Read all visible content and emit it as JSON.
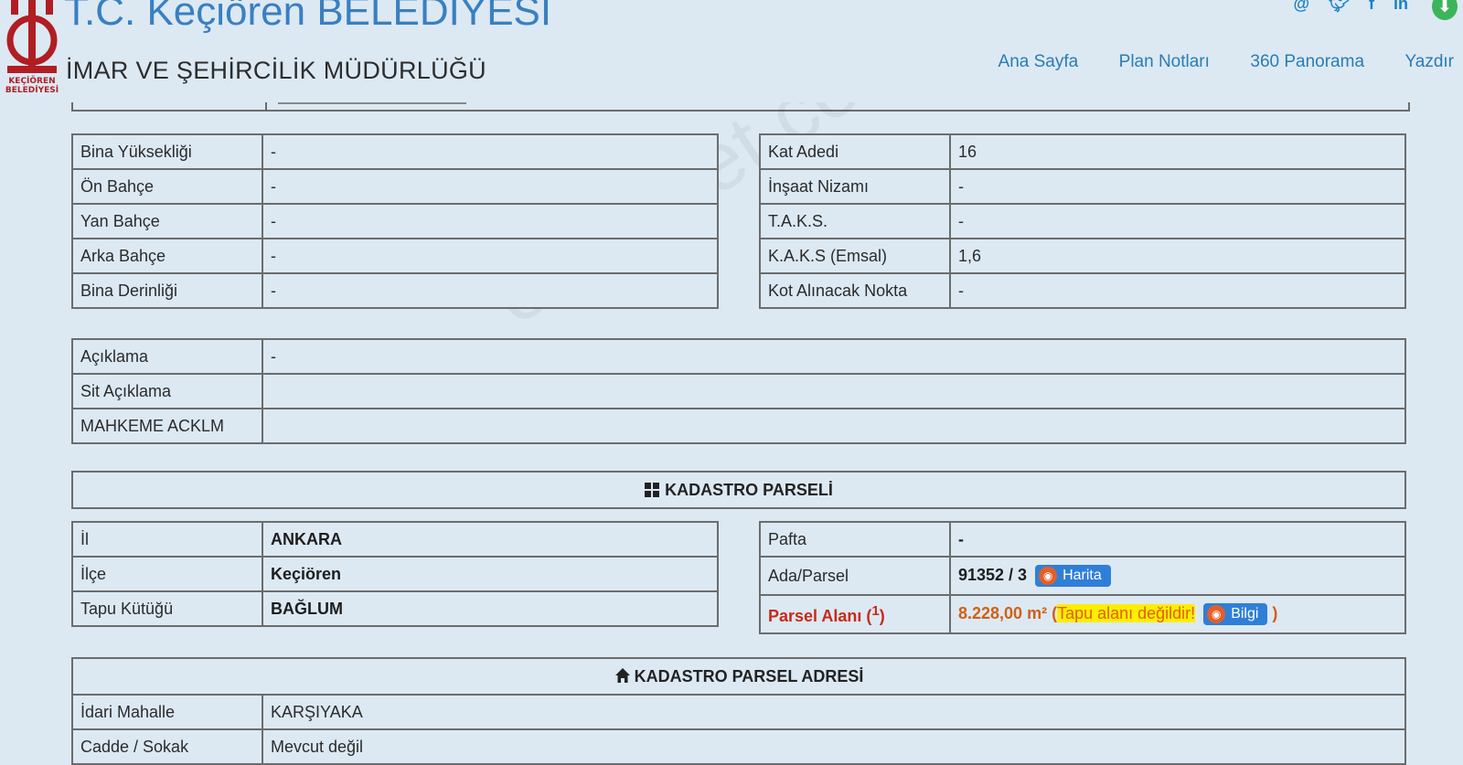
{
  "header": {
    "logo_text": "KEÇİÖREN BELEDİYESİ",
    "title": "T.C. Keçiören BELEDİYESİ",
    "subtitle": "İMAR VE ŞEHİRCİLİK MÜDÜRLÜĞÜ",
    "social": [
      "@",
      "twitter-icon",
      "facebook-icon",
      "linkedin-icon"
    ],
    "nav": [
      "Ana Sayfa",
      "Plan Notları",
      "360 Panorama",
      "Yazdır"
    ]
  },
  "building_left": [
    {
      "label": "Bina Yüksekliği",
      "value": "-"
    },
    {
      "label": "Ön Bahçe",
      "value": "-"
    },
    {
      "label": "Yan Bahçe",
      "value": "-"
    },
    {
      "label": "Arka Bahçe",
      "value": "-"
    },
    {
      "label": "Bina Derinliği",
      "value": "-"
    }
  ],
  "building_right": [
    {
      "label": "Kat Adedi",
      "value": "16"
    },
    {
      "label": "İnşaat Nizamı",
      "value": "-"
    },
    {
      "label": "T.A.K.S.",
      "value": "-"
    },
    {
      "label": "K.A.K.S (Emsal)",
      "value": "1,6"
    },
    {
      "label": "Kot Alınacak Nokta",
      "value": "-"
    }
  ],
  "notes": [
    {
      "label": "Açıklama",
      "value": "-"
    },
    {
      "label": "Sit Açıklama",
      "value": ""
    },
    {
      "label": "MAHKEME ACKLM",
      "value": ""
    }
  ],
  "kadastro": {
    "heading": "KADASTRO PARSELİ",
    "left": [
      {
        "label": "İl",
        "value": "ANKARA"
      },
      {
        "label": "İlçe",
        "value": "Keçiören"
      },
      {
        "label": "Tapu Kütüğü",
        "value": "BAĞLUM"
      }
    ],
    "pafta_label": "Pafta",
    "pafta_value": "-",
    "ada_label": "Ada/Parsel",
    "ada_value": "91352 / 3",
    "harita_button": "Harita",
    "parsel_label": "Parsel Alanı (",
    "parsel_sup": "1",
    "parsel_label_end": ")",
    "parsel_value": "8.228,00 m² (",
    "tapu_warning": "Tapu alanı değildir!",
    "bilgi_button": "Bilgi",
    "parsel_value_end": " )"
  },
  "adres": {
    "heading": "KADASTRO PARSEL ADRESİ",
    "rows": [
      {
        "label": "İdari Mahalle",
        "value": "KARŞIYAKA"
      },
      {
        "label": "Cadde / Sokak",
        "value": "Mevcut değil"
      }
    ]
  },
  "watermark": "emlakjet.com"
}
